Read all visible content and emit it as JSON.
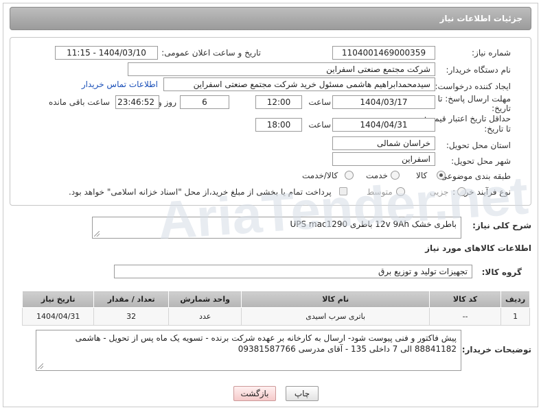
{
  "header": {
    "title": "جزئیات اطلاعات نیاز"
  },
  "form": {
    "need_number_label": "شماره نیاز:",
    "need_number": "1104001469000359",
    "announce_label": "تاریخ و ساعت اعلان عمومی:",
    "announce_value": "1404/03/10 - 11:15",
    "buyer_org_label": "نام دستگاه خریدار:",
    "buyer_org": "شرکت مجتمع صنعتی اسفراین",
    "creator_label": "ایجاد کننده درخواست:",
    "creator": "سیدمحمدابراهیم هاشمی مسئول خرید شرکت مجتمع صنعتی اسفراین",
    "contact_link": "اطلاعات تماس خریدار",
    "deadline_label_1": "مهلت ارسال پاسخ: تا",
    "deadline_label_2": "تاریخ:",
    "deadline_date": "1404/03/17",
    "time_label": "ساعت",
    "deadline_time": "12:00",
    "days_value": "6",
    "days_label": "روز و",
    "remaining_value": "23:46:52",
    "remaining_label": "ساعت باقی مانده",
    "validity_label_1": "حداقل تاریخ اعتبار قیمت:",
    "validity_label_2": "تا تاریخ:",
    "validity_date": "1404/04/31",
    "validity_time": "18:00",
    "province_label": "استان محل تحویل:",
    "province": "خراسان شمالی",
    "city_label": "شهر محل تحویل:",
    "city": "اسفراین",
    "category_label": "طبقه بندی موضوعی:",
    "category_options": [
      "کالا",
      "خدمت",
      "کالا/خدمت"
    ],
    "process_label": "نوع فرآیند خرید :",
    "process_options": [
      "جزیی",
      "متوسط"
    ],
    "payment_note": "پرداخت تمام یا بخشی از مبلغ خرید،از محل \"اسناد خزانه اسلامی\" خواهد بود."
  },
  "general_desc": {
    "label": "شرح کلی نیاز:",
    "value": "باطری خشک 12v 9Ah باطری UPS mac1290"
  },
  "goods_section": {
    "title": "اطلاعات کالاهای مورد نیاز",
    "group_label": "گروه کالا:",
    "group_value": "تجهیزات تولید و توزیع برق"
  },
  "table": {
    "headers": [
      "ردیف",
      "کد کالا",
      "نام کالا",
      "واحد شمارش",
      "تعداد / مقدار",
      "تاریخ نیاز"
    ],
    "rows": [
      {
        "row": "1",
        "code": "--",
        "name": "باتری سرب اسیدی",
        "unit": "عدد",
        "qty": "32",
        "date": "1404/04/31"
      }
    ]
  },
  "buyer_notes": {
    "label": "توضیحات خریدار:",
    "value": "پیش فاکتور و فنی پیوست شود- ارسال به کارخانه بر عهده شرکت برنده - تسویه یک ماه پس از تحویل - هاشمی 88841182 الی 7 داخلی 135 - آقای مدرسی 09381587766"
  },
  "buttons": {
    "print": "چاپ",
    "back": "بازگشت"
  },
  "watermark": {
    "text": "AriaTender.net"
  }
}
